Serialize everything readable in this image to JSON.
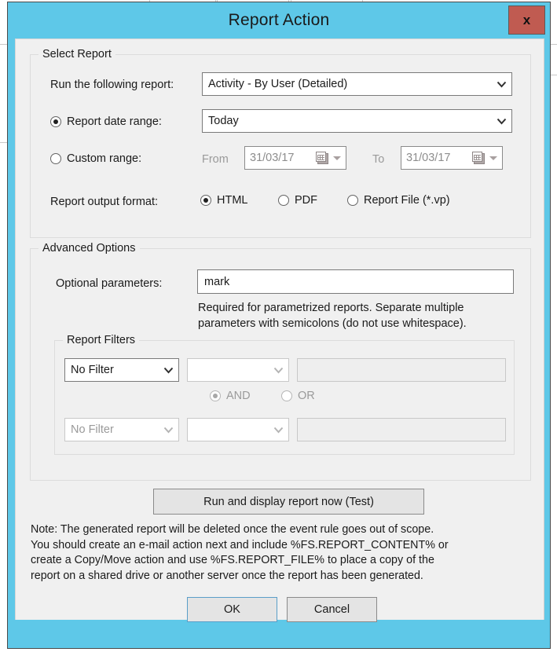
{
  "window": {
    "title": "Report Action",
    "close_label": "x",
    "accent_color": "#5ec8e8",
    "close_color": "#c05b51",
    "surface_color": "#f0f0f0"
  },
  "select_report": {
    "group_title": "Select Report",
    "run_report_label": "Run the following report:",
    "report_select_value": "Activity - By User (Detailed)",
    "date_range_radio_label": "Report date range:",
    "date_range_select_value": "Today",
    "custom_range_radio_label": "Custom range:",
    "from_label": "From",
    "from_value": "31/03/17",
    "to_label": "To",
    "to_value": "31/03/17",
    "output_format_label": "Report output format:",
    "format_options": [
      {
        "label": "HTML",
        "checked": true
      },
      {
        "label": "PDF",
        "checked": false
      },
      {
        "label": "Report File (*.vp)",
        "checked": false
      }
    ]
  },
  "advanced_options": {
    "group_title": "Advanced Options",
    "optional_params_label": "Optional parameters:",
    "optional_params_value": "mark",
    "hint_line_1": "Required for parametrized reports. Separate multiple",
    "hint_line_2": "parameters with semicolons (do not use whitespace).",
    "filters": {
      "group_title": "Report Filters",
      "row1": {
        "filter_value": "No Filter",
        "field_value": "",
        "text_value": ""
      },
      "row2": {
        "filter_value": "No Filter",
        "field_value": "",
        "text_value": ""
      },
      "and_label": "AND",
      "or_label": "OR",
      "and_checked": true,
      "or_checked": false
    }
  },
  "footer": {
    "run_test_button": "Run and display report now (Test)",
    "note_line_1": "Note: The generated report will be deleted once the event rule goes out of scope.",
    "note_line_2": "You should create an e-mail action next and include %FS.REPORT_CONTENT% or",
    "note_line_3": "create a Copy/Move action and use %FS.REPORT_FILE% to place a copy of the",
    "note_line_4": "report on a shared drive or another server once the report has been generated.",
    "ok_button": "OK",
    "cancel_button": "Cancel"
  }
}
